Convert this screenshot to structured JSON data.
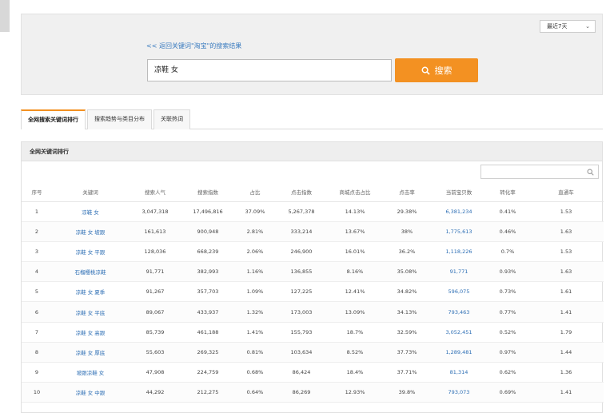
{
  "top_bar": {
    "title_fragment": ""
  },
  "search_panel": {
    "range_select": "最近7天",
    "back_link": "<< 返回关键词\"淘宝\"的搜索结果",
    "query": "凉鞋 女",
    "search_button": "搜索"
  },
  "tabs": [
    {
      "label": "全网搜索关键词排行",
      "active": true
    },
    {
      "label": "搜索趋势与类目分布",
      "active": false
    },
    {
      "label": "关联热词",
      "active": false
    }
  ],
  "results": {
    "header": "全网关键词排行",
    "filter_placeholder": "",
    "columns": [
      "序号",
      "关键词",
      "搜索人气",
      "搜索指数",
      "占比",
      "点击指数",
      "商城点击占比",
      "点击率",
      "当前宝贝数",
      "转化率",
      "直通车"
    ],
    "rows": [
      [
        "1",
        "凉鞋 女",
        "3,047,318",
        "17,496,816",
        "37.09%",
        "5,267,378",
        "14.13%",
        "29.38%",
        "6,381,234",
        "0.41%",
        "1.53"
      ],
      [
        "2",
        "凉鞋 女 坡跟",
        "161,613",
        "900,948",
        "2.81%",
        "333,214",
        "13.67%",
        "38%",
        "1,775,613",
        "0.46%",
        "1.63"
      ],
      [
        "3",
        "凉鞋 女 平跟",
        "128,036",
        "668,239",
        "2.06%",
        "246,900",
        "16.01%",
        "36.2%",
        "1,118,226",
        "0.7%",
        "1.53"
      ],
      [
        "4",
        "石榴樱桃凉鞋",
        "91,771",
        "382,993",
        "1.16%",
        "136,855",
        "8.16%",
        "35.08%",
        "91,771",
        "0.93%",
        "1.63"
      ],
      [
        "5",
        "凉鞋 女 夏季",
        "91,267",
        "357,703",
        "1.09%",
        "127,225",
        "12.41%",
        "34.82%",
        "596,075",
        "0.73%",
        "1.61"
      ],
      [
        "6",
        "凉鞋 女 平底",
        "89,067",
        "433,937",
        "1.32%",
        "173,003",
        "13.09%",
        "34.13%",
        "793,463",
        "0.77%",
        "1.41"
      ],
      [
        "7",
        "凉鞋 女 高跟",
        "85,739",
        "461,188",
        "1.41%",
        "155,793",
        "18.7%",
        "32.59%",
        "3,052,451",
        "0.52%",
        "1.79"
      ],
      [
        "8",
        "凉鞋 女 厚底",
        "55,603",
        "269,325",
        "0.81%",
        "103,634",
        "8.52%",
        "37.73%",
        "1,289,481",
        "0.97%",
        "1.44"
      ],
      [
        "9",
        "坡跟凉鞋 女",
        "47,908",
        "224,759",
        "0.68%",
        "86,424",
        "18.4%",
        "37.71%",
        "81,314",
        "0.62%",
        "1.36"
      ],
      [
        "10",
        "凉鞋 女 中跟",
        "44,292",
        "212,275",
        "0.64%",
        "86,269",
        "12.93%",
        "39.8%",
        "793,073",
        "0.69%",
        "1.41"
      ]
    ]
  },
  "colors": {
    "accent": "#f39122",
    "link": "#2e6fb5",
    "panel": "#f0f0f0"
  }
}
